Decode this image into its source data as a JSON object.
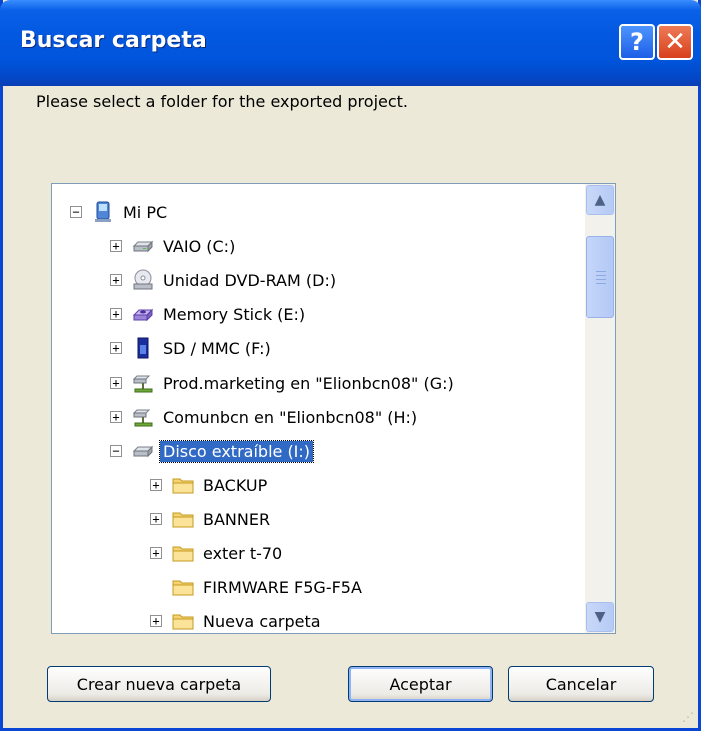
{
  "window": {
    "title": "Buscar carpeta"
  },
  "prompt": "Please select a folder for the exported project.",
  "tree": {
    "items": [
      {
        "label": "Mi PC",
        "icon": "computer-icon",
        "expander": "−",
        "indent": 0
      },
      {
        "label": "VAIO (C:)",
        "icon": "hard-drive-icon",
        "expander": "+",
        "indent": 1
      },
      {
        "label": "Unidad DVD-RAM (D:)",
        "icon": "dvd-drive-icon",
        "expander": "+",
        "indent": 1
      },
      {
        "label": "Memory Stick (E:)",
        "icon": "memory-stick-icon",
        "expander": "+",
        "indent": 1
      },
      {
        "label": "SD / MMC (F:)",
        "icon": "sd-card-icon",
        "expander": "+",
        "indent": 1
      },
      {
        "label": "Prod.marketing en \"Elionbcn08\" (G:)",
        "icon": "network-drive-icon",
        "expander": "+",
        "indent": 1
      },
      {
        "label": "Comunbcn en \"Elionbcn08\" (H:)",
        "icon": "network-drive-icon",
        "expander": "+",
        "indent": 1
      },
      {
        "label": "Disco extraíble (I:)",
        "icon": "removable-drive-icon",
        "expander": "−",
        "indent": 1,
        "selected": true
      },
      {
        "label": "BACKUP",
        "icon": "folder-icon",
        "expander": "+",
        "indent": 2
      },
      {
        "label": "BANNER",
        "icon": "folder-icon",
        "expander": "+",
        "indent": 2
      },
      {
        "label": "exter t-70",
        "icon": "folder-icon",
        "expander": "+",
        "indent": 2
      },
      {
        "label": "FIRMWARE F5G-F5A",
        "icon": "folder-icon",
        "expander": "",
        "indent": 2
      },
      {
        "label": "Nueva carpeta",
        "icon": "folder-icon",
        "expander": "+",
        "indent": 2
      }
    ]
  },
  "buttons": {
    "new_folder": "Crear nueva carpeta",
    "accept": "Aceptar",
    "cancel": "Cancelar"
  },
  "titlebar_buttons": {
    "help": "?",
    "close": "✕"
  },
  "scrollbar": {
    "up": "▲",
    "down": "▼"
  },
  "colors": {
    "titlebar": "#0358e0",
    "selection": "#316ac5",
    "dialog_bg": "#ece9d8"
  }
}
